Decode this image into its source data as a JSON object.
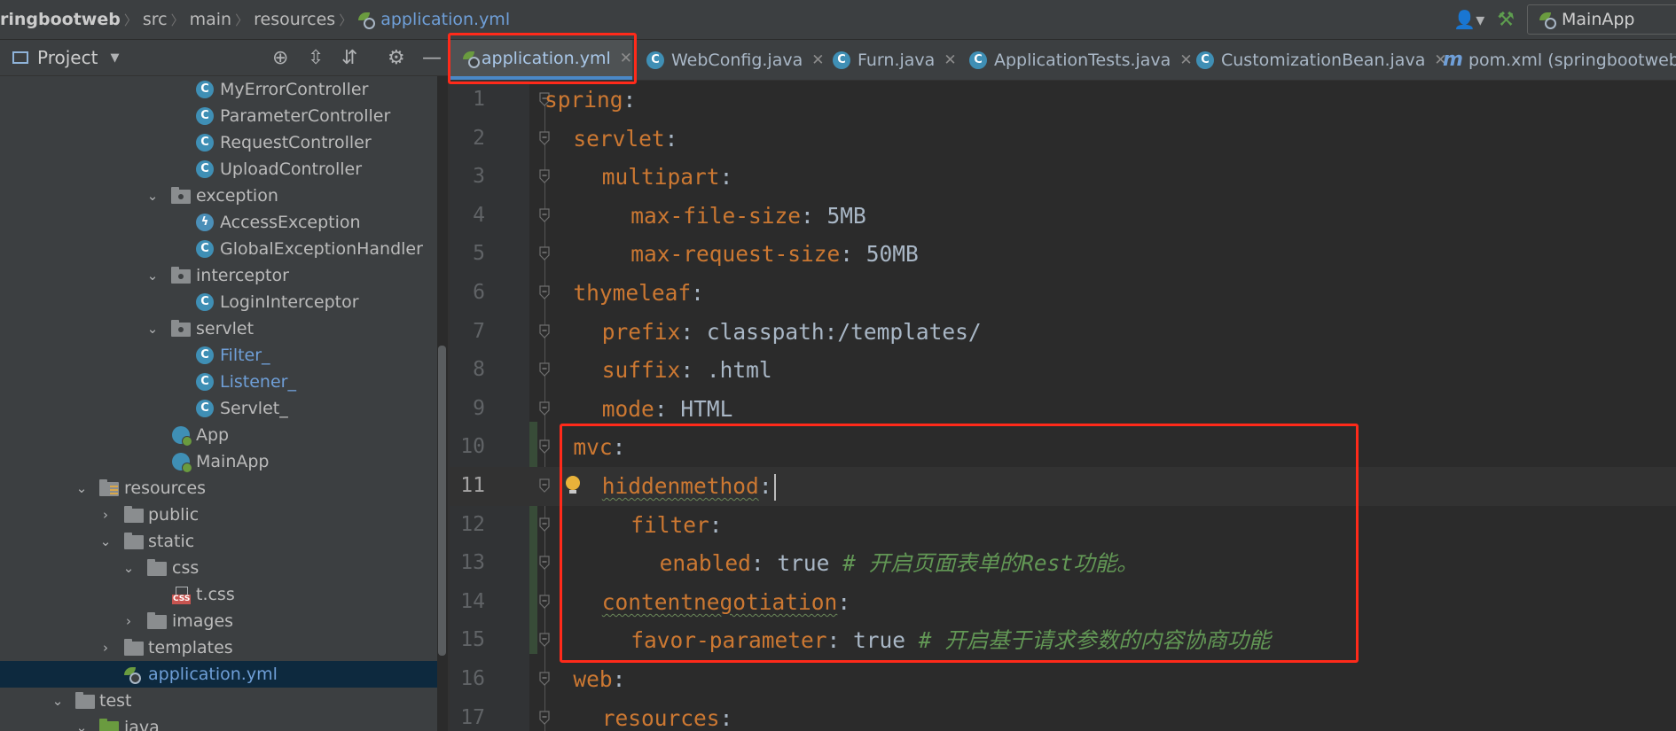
{
  "breadcrumb": {
    "items": [
      "ringbootweb",
      "src",
      "main",
      "resources"
    ],
    "file": "application.yml"
  },
  "toolbar": {
    "run_config": "MainApp",
    "run_config_arrow": "▾"
  },
  "project_panel": {
    "title": "Project",
    "tree": [
      {
        "label": "MyErrorController",
        "icon": "class"
      },
      {
        "label": "ParameterController",
        "icon": "class"
      },
      {
        "label": "RequestController",
        "icon": "class"
      },
      {
        "label": "UploadController",
        "icon": "class"
      },
      {
        "label": "exception",
        "icon": "package",
        "expanded": true
      },
      {
        "label": "AccessException",
        "icon": "exception-class"
      },
      {
        "label": "GlobalExceptionHandler",
        "icon": "class"
      },
      {
        "label": "interceptor",
        "icon": "package",
        "expanded": true
      },
      {
        "label": "LoginInterceptor",
        "icon": "class"
      },
      {
        "label": "servlet",
        "icon": "package",
        "expanded": true
      },
      {
        "label": "Filter_",
        "icon": "class",
        "modified": true
      },
      {
        "label": "Listener_",
        "icon": "class",
        "modified": true
      },
      {
        "label": "Servlet_",
        "icon": "class"
      },
      {
        "label": "App",
        "icon": "spring-boot-app"
      },
      {
        "label": "MainApp",
        "icon": "spring-boot-app"
      },
      {
        "label": "resources",
        "icon": "resources-folder",
        "expanded": true
      },
      {
        "label": "public",
        "icon": "folder",
        "expanded": false
      },
      {
        "label": "static",
        "icon": "folder",
        "expanded": true
      },
      {
        "label": "css",
        "icon": "folder",
        "expanded": true
      },
      {
        "label": "t.css",
        "icon": "css-file"
      },
      {
        "label": "images",
        "icon": "folder",
        "expanded": false
      },
      {
        "label": "templates",
        "icon": "folder",
        "expanded": false
      },
      {
        "label": "application.yml",
        "icon": "yaml-file",
        "selected": true
      },
      {
        "label": "test",
        "icon": "folder",
        "expanded": true
      },
      {
        "label": "java",
        "icon": "test-source-folder",
        "expanded": true
      }
    ]
  },
  "tabs": [
    {
      "label": "application.yml",
      "icon": "yaml-icon",
      "active": true
    },
    {
      "label": "WebConfig.java",
      "icon": "class-icon"
    },
    {
      "label": "Furn.java",
      "icon": "class-icon"
    },
    {
      "label": "ApplicationTests.java",
      "icon": "test-class-icon"
    },
    {
      "label": "CustomizationBean.java",
      "icon": "class-icon"
    },
    {
      "label": "pom.xml (springbootweb)",
      "icon": "maven-icon"
    }
  ],
  "editor": {
    "current_line": 11,
    "lines": [
      {
        "n": "1",
        "indent": 0,
        "key": "spring",
        "sep": ":",
        "val": "",
        "comment": ""
      },
      {
        "n": "2",
        "indent": 1,
        "key": "servlet",
        "sep": ":",
        "val": "",
        "comment": ""
      },
      {
        "n": "3",
        "indent": 2,
        "key": "multipart",
        "sep": ":",
        "val": "",
        "comment": ""
      },
      {
        "n": "4",
        "indent": 3,
        "key": "max-file-size",
        "sep": ": ",
        "val": "5MB",
        "comment": ""
      },
      {
        "n": "5",
        "indent": 3,
        "key": "max-request-size",
        "sep": ": ",
        "val": "50MB",
        "comment": ""
      },
      {
        "n": "6",
        "indent": 1,
        "key": "thymeleaf",
        "sep": ":",
        "val": "",
        "comment": ""
      },
      {
        "n": "7",
        "indent": 2,
        "key": "prefix",
        "sep": ": ",
        "val": "classpath:/templates/",
        "comment": ""
      },
      {
        "n": "8",
        "indent": 2,
        "key": "suffix",
        "sep": ": ",
        "val": ".html",
        "comment": ""
      },
      {
        "n": "9",
        "indent": 2,
        "key": "mode",
        "sep": ": ",
        "val": "HTML",
        "comment": ""
      },
      {
        "n": "10",
        "indent": 1,
        "key": "mvc",
        "sep": ":",
        "val": "",
        "comment": ""
      },
      {
        "n": "11",
        "indent": 2,
        "key": "hiddenmethod",
        "sep": ":",
        "val": "",
        "comment": ""
      },
      {
        "n": "12",
        "indent": 3,
        "key": "filter",
        "sep": ":",
        "val": "",
        "comment": ""
      },
      {
        "n": "13",
        "indent": 4,
        "key": "enabled",
        "sep": ": ",
        "val": "true ",
        "comment": "# 开启页面表单的Rest功能。"
      },
      {
        "n": "14",
        "indent": 2,
        "key": "contentnegotiation",
        "sep": ":",
        "val": "",
        "comment": ""
      },
      {
        "n": "15",
        "indent": 3,
        "key": "favor-parameter",
        "sep": ": ",
        "val": "true ",
        "comment": "# 开启基于请求参数的内容协商功能"
      },
      {
        "n": "16",
        "indent": 1,
        "key": "web",
        "sep": ":",
        "val": "",
        "comment": ""
      },
      {
        "n": "17",
        "indent": 2,
        "key": "resources",
        "sep": ":",
        "val": "",
        "comment": ""
      }
    ]
  },
  "colors": {
    "highlight_box": "#ff2a1a",
    "yaml_key": "#cc7832",
    "comment": "#629755",
    "selection": "#0d293e"
  }
}
